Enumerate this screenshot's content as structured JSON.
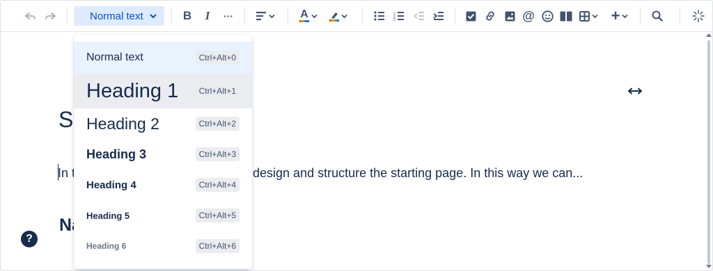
{
  "toolbar": {
    "text_style": "Normal text",
    "buttons": {
      "undo": "undo-icon",
      "redo": "redo-icon",
      "bold": "B",
      "italic": "I",
      "more_formatting": "···",
      "align": "align-icon",
      "text_color": "A",
      "highlight": "highlight-icon",
      "bullet_list": "bullet-list-icon",
      "numbered_list": "numbered-list-icon",
      "outdent": "outdent-icon",
      "indent": "indent-icon",
      "action_item": "checkbox-icon",
      "link": "link-icon",
      "image": "image-icon",
      "mention": "@",
      "emoji": "emoji-icon",
      "layouts": "layout-icon",
      "table": "table-icon",
      "insert": "+",
      "find": "search-icon",
      "ai": "sparkle-icon"
    }
  },
  "dropdown": {
    "items": [
      {
        "label": "Normal text",
        "shortcut": "Ctrl+Alt+0"
      },
      {
        "label": "Heading 1",
        "shortcut": "Ctrl+Alt+1"
      },
      {
        "label": "Heading 2",
        "shortcut": "Ctrl+Alt+2"
      },
      {
        "label": "Heading 3",
        "shortcut": "Ctrl+Alt+3"
      },
      {
        "label": "Heading 4",
        "shortcut": "Ctrl+Alt+4"
      },
      {
        "label": "Heading 5",
        "shortcut": "Ctrl+Alt+5"
      },
      {
        "label": "Heading 6",
        "shortcut": "Ctrl+Alt+6"
      }
    ]
  },
  "editor": {
    "heading_fragment": "St",
    "paragraph_start": "In t",
    "paragraph_end": "design and structure the starting page. In this way we can...",
    "subheading_fragment": "Na"
  },
  "help": {
    "label": "?"
  },
  "colors": {
    "accent": "#0052cc",
    "selected_bg": "#deebff",
    "text": "#172b4d"
  }
}
